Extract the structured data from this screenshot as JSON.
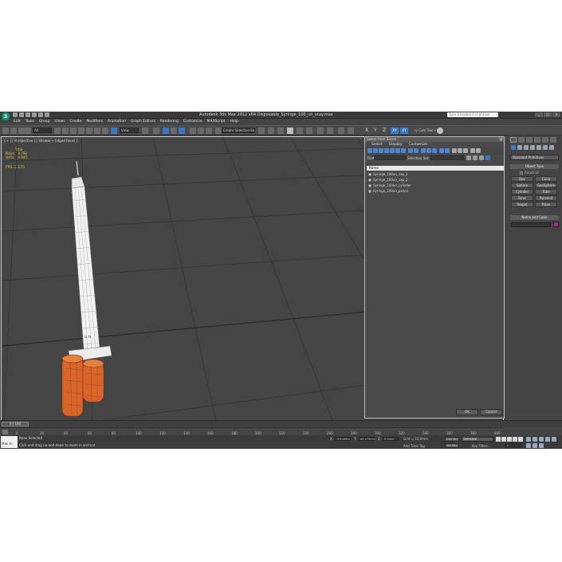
{
  "window": {
    "title": "Autodesk 3ds Max  2012 x64     Disposable_Syringe_100_un_vray.max",
    "search_placeholder": "Type a keyword or phrase",
    "min_label": "_",
    "max_label": "□",
    "close_label": "x"
  },
  "menu": [
    "Edit",
    "Tools",
    "Group",
    "Views",
    "Create",
    "Modifiers",
    "Animation",
    "Graph Editors",
    "Rendering",
    "Customize",
    "MAXScript",
    "Help"
  ],
  "toolbar": {
    "selection_filter": "All",
    "ref_coord": "View",
    "named_selection": "Create Selection Se",
    "axes": [
      "X",
      "Y",
      "Z",
      "XY",
      "XY"
    ],
    "camera_tool": "ry Cam Tool •"
  },
  "viewport": {
    "label": "[ + ] [ Perspective ] [ Shaded + Edged Faces ]",
    "stats_header": "Total",
    "polys_label": "Polys:",
    "polys_value": "9 792",
    "verts_label": "Verts:",
    "verts_value": "4 945",
    "fps_label": "FPS:",
    "fps_value": "2.175",
    "syringe_mark": "u n"
  },
  "scene_explorer": {
    "title": "Select From Scene",
    "close_label": "x",
    "menu": [
      "Select",
      "Display",
      "Customize"
    ],
    "find_label": "Find:",
    "selection_set_label": "Selection Set:",
    "column_header": "Name",
    "items": [
      "Syringe_100un_cap_1",
      "Syringe_100un_cap_2",
      "Syringe_100un_cylinder",
      "Syringe_100un_piston"
    ],
    "ok_label": "OK",
    "cancel_label": "Cancel"
  },
  "command_panel": {
    "dropdown": "Standard Primitives",
    "object_type_title": "Object Type",
    "autogrid_label": "AutoGrid",
    "objects": [
      "Box",
      "Cone",
      "Sphere",
      "GeoSphere",
      "Cylinder",
      "Tube",
      "Torus",
      "Pyramid",
      "Teapot",
      "Plane"
    ],
    "name_color_title": "Name and Color",
    "color": "#c0267b"
  },
  "timeline": {
    "frame_display": "0 / 100",
    "ticks": [
      "0",
      "10",
      "20",
      "30",
      "40",
      "50",
      "60",
      "70",
      "80",
      "90",
      "100",
      "110",
      "120",
      "130",
      "140",
      "150",
      "160",
      "170",
      "180",
      "190",
      "200",
      "210",
      "220",
      "230",
      "240",
      "250",
      "260",
      "270",
      "280",
      "290",
      "300",
      "310",
      "320",
      "330",
      "340",
      "350",
      "360",
      "370",
      "380",
      "390",
      "400"
    ]
  },
  "status": {
    "maxscript_label": "Max to",
    "selection_text": "None Selected",
    "prompt_text": "Click and drag up-and-down to zoom in and out",
    "x_label": "X:",
    "x_value": "-53.186m",
    "y_label": "Y:",
    "y_value": "60.174mm",
    "z_label": "Z:",
    "z_value": "0.0mm",
    "grid_label": "Grid = 10.0mm",
    "add_time_tag": "Add Time Tag",
    "auto_key": "Auto Key",
    "set_key": "Set Key",
    "key_filters": "Key Filters...",
    "selected_dropdown": "Selected",
    "frame_field": "0"
  },
  "colors": {
    "selection_blue": "#3a78c9",
    "syringe_cap_orange": "#d9652a",
    "stats_yellow": "#e6d23a"
  }
}
